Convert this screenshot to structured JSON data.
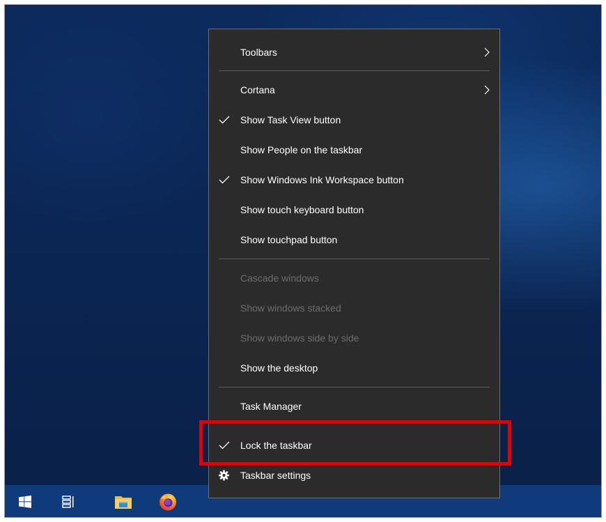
{
  "menu": {
    "toolbars": "Toolbars",
    "cortana": "Cortana",
    "show_task_view": "Show Task View button",
    "show_people": "Show People on the taskbar",
    "show_ink_workspace": "Show Windows Ink Workspace button",
    "show_touch_keyboard": "Show touch keyboard button",
    "show_touchpad": "Show touchpad button",
    "cascade_windows": "Cascade windows",
    "show_windows_stacked": "Show windows stacked",
    "show_windows_side_by_side": "Show windows side by side",
    "show_desktop": "Show the desktop",
    "task_manager": "Task Manager",
    "lock_taskbar": "Lock the taskbar",
    "taskbar_settings": "Taskbar settings"
  },
  "checked": {
    "show_task_view": true,
    "show_ink_workspace": true,
    "lock_taskbar": true
  },
  "taskbar": {
    "icons": [
      "windows-start-icon",
      "task-view-icon",
      "file-explorer-icon",
      "firefox-icon"
    ]
  },
  "colors": {
    "menu_bg": "#2b2b2b",
    "menu_text": "#ffffff",
    "disabled_text": "#6d6d6d",
    "highlight": "#e60000",
    "taskbar": "#0f3b7d"
  }
}
